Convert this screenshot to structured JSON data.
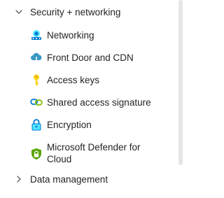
{
  "security_group": {
    "label": "Security + networking",
    "expanded": true,
    "items": [
      {
        "label": "Networking",
        "icon": "networking-icon"
      },
      {
        "label": "Front Door and CDN",
        "icon": "front-door-cdn-icon"
      },
      {
        "label": "Access keys",
        "icon": "key-icon"
      },
      {
        "label": "Shared access signature",
        "icon": "link-icon"
      },
      {
        "label": "Encryption",
        "icon": "encryption-lock-icon"
      },
      {
        "label": "Microsoft Defender for Cloud",
        "icon": "defender-shield-icon"
      }
    ]
  },
  "data_group": {
    "label": "Data management",
    "expanded": false
  },
  "colors": {
    "text": "#242424",
    "azure_blue": "#0078d4",
    "light_blue": "#50e6ff",
    "key_yellow": "#fcd116",
    "defender_green": "#5ea0ef",
    "scrollbar": "#e6e6e6"
  }
}
